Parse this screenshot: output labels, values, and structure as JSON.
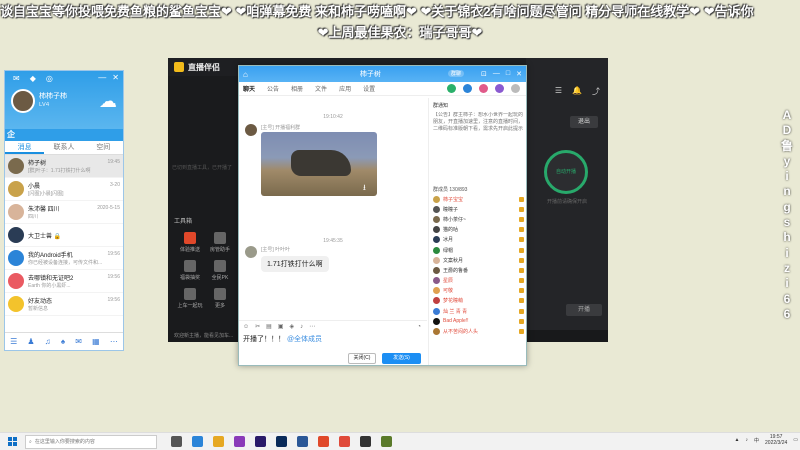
{
  "danmaku": {
    "line1": "谈自宝宝等你投喂免费鱼粮的鲨鱼宝宝❤ ❤咱弹幕免费 来和柿子唠嗑啊❤ ❤关于锦衣2有啥问题尽管问 精分导师在线教学❤ ❤告诉你",
    "line2": "❤上周最佳果农：瑞子哥哥❤",
    "vertical": [
      "A",
      "D",
      "鲁",
      "y",
      "i",
      "n",
      "g",
      "s",
      "h",
      "i",
      "z",
      "i",
      "6",
      "6"
    ]
  },
  "qq": {
    "user_name": "柿柿子柿",
    "signature": "LV4",
    "qzone_label": "企",
    "tabs": [
      "消息",
      "联系人",
      "空间"
    ],
    "active_tab": "消息",
    "items": [
      {
        "name": "柿子树",
        "msg": "[群]叶子：1.71打铁打什么啊",
        "time": "19:45",
        "color": "#7a6a4d",
        "selected": true
      },
      {
        "name": "小晨",
        "msg": "[闪图]小晨[闪图]",
        "time": "3-20",
        "color": "#c9a24a"
      },
      {
        "name": "朱沛馨 四川",
        "msg": "四川",
        "time": "2020-5-15",
        "color": "#d8b49a"
      },
      {
        "name": "大卫士兽 🔒",
        "msg": "",
        "time": "",
        "color": "#2a3c55"
      },
      {
        "name": "我的Android手机",
        "msg": "你已经被设备连接，可传文件和...",
        "time": "19:56",
        "color": "#2b84d8"
      },
      {
        "name": "去哪镇和无证吧2",
        "msg": "Earth 你的小黑虾...",
        "time": "19:56",
        "color": "#ea5a62"
      },
      {
        "name": "好友动态",
        "msg": "暂新信息",
        "time": "19:56",
        "color": "#f3c32c"
      }
    ],
    "footer_icons": [
      "menu-icon",
      "contacts-icon",
      "music-icon",
      "game-icon",
      "mail-icon",
      "apps-icon",
      "more-icon"
    ]
  },
  "stream": {
    "app_name": "直播伴侣",
    "left_hint": "已切到直播工具，已开播了",
    "tools_label": "工具箱",
    "tools": [
      {
        "label": "体验推送",
        "color": "#e0482a"
      },
      {
        "label": "房管助手",
        "color": "#666"
      },
      {
        "label": "福袋抽奖",
        "color": "#666"
      },
      {
        "label": "全民PK",
        "color": "#666"
      },
      {
        "label": "上车一起玩",
        "color": "#666"
      },
      {
        "label": "更多",
        "color": "#666"
      }
    ],
    "exit_label": "退出",
    "ring_label": "自动开播",
    "ring_sub": "开播前请确保开启",
    "bottom_text": "欢迎新主播，能看见加车...",
    "golive_label": "开播",
    "bottom_right": "100%  16%"
  },
  "chat": {
    "group_title": "柿子树",
    "tag": "群聊",
    "tabs": [
      "聊天",
      "公告",
      "相册",
      "文件",
      "应用",
      "设置"
    ],
    "active_tab": "聊天",
    "time1": "19:10:42",
    "sender1": "[主号] 开播福利群",
    "time2": "19:45:35",
    "sender2": "[主号] 叶叶叶",
    "bubble": "1.71打铁打什么啊",
    "compose_text": "开播了！！！",
    "compose_at": "@全体成员",
    "close_btn": "关闭(C)",
    "send_btn": "发送(S)",
    "notice_header": "群通知",
    "notice_body": "【公告】群主柿子：想水小世界一起玩的朋友，开直播加速里，注意的直播时间，",
    "notice_body2": "二维码标准版朝下看，需求先开启此提示",
    "member_header": "群成员 130/893",
    "members": [
      {
        "name": "柿子宝宝",
        "color": "#e04a3a",
        "a": "#c9a24a"
      },
      {
        "name": "瞳瞳子",
        "color": "#333",
        "a": "#555"
      },
      {
        "name": "柿小茶仔~",
        "color": "#333",
        "a": "#7a6a4d"
      },
      {
        "name": "猫的咕",
        "color": "#333",
        "a": "#444"
      },
      {
        "name": "冰月",
        "color": "#333",
        "a": "#2a3c55"
      },
      {
        "name": "绿帽",
        "color": "#333",
        "a": "#2b8a3e"
      },
      {
        "name": "文案秋月",
        "color": "#333",
        "a": "#d8b49a"
      },
      {
        "name": "王爵的鲁番",
        "color": "#333",
        "a": "#6c5a43"
      },
      {
        "name": "星辰",
        "color": "#e04a3a",
        "a": "#8a5a8a"
      },
      {
        "name": "可敬",
        "color": "#e04a3a",
        "a": "#e0a050"
      },
      {
        "name": "梦花瞳萌",
        "color": "#e04a3a",
        "a": "#c04040"
      },
      {
        "name": "灿 兰 青 青",
        "color": "#e04a3a",
        "a": "#3a7bd5"
      },
      {
        "name": "Bad Apple!!",
        "color": "#e04a3a",
        "a": "#111"
      },
      {
        "name": "从不苦闷的人头",
        "color": "#e04a3a",
        "a": "#aa7733"
      }
    ]
  },
  "taskbar": {
    "search_placeholder": "在这里输入你要搜索的内容",
    "apps": [
      {
        "name": "task-view-icon",
        "color": "#555"
      },
      {
        "name": "edge-icon",
        "color": "#2b84d8"
      },
      {
        "name": "files-icon",
        "color": "#e6a823"
      },
      {
        "name": "app-icon",
        "color": "#8a3ab9"
      },
      {
        "name": "premiere-icon",
        "color": "#2a1a6a"
      },
      {
        "name": "photoshop-icon",
        "color": "#0a2a5a"
      },
      {
        "name": "word-icon",
        "color": "#2b5797"
      },
      {
        "name": "red-app-icon",
        "color": "#e0482a"
      },
      {
        "name": "chrome-icon",
        "color": "#e04a3a"
      },
      {
        "name": "obs-icon",
        "color": "#333"
      },
      {
        "name": "game-icon",
        "color": "#5a7a2a"
      }
    ],
    "time": "19:57",
    "date": "2022/3/24"
  }
}
